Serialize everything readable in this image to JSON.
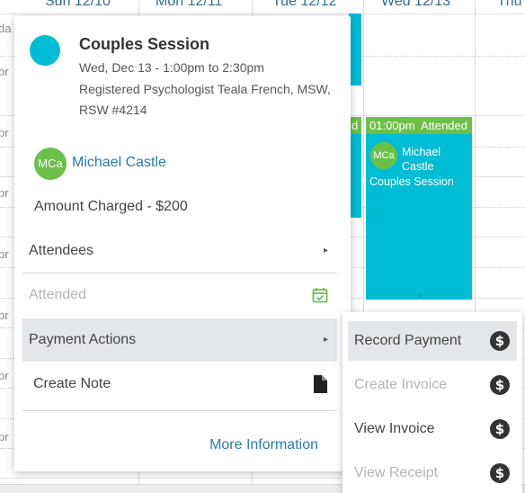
{
  "calendar": {
    "days": [
      "Sun 12/10",
      "Mon 12/11",
      "Tue 12/12",
      "Wed 12/13",
      "Thu"
    ],
    "time_labels": [
      "da",
      "pr",
      "pr",
      "pr",
      "pr",
      "pr",
      "pr",
      "pr"
    ],
    "event": {
      "header_time": "01:00pm",
      "header_status": "Attended",
      "avatar_initials": "MCa",
      "client_name": "Michael Castle",
      "session": "Couples Session",
      "handle": "=",
      "color": "#00bcd4",
      "status_color": "#6cc04a"
    },
    "fragment_label": "d"
  },
  "popover": {
    "title": "Couples Session",
    "datetime": "Wed, Dec 13 - 1:00pm to 2:30pm",
    "provider_line1": "Registered Psychologist Teala French, MSW,",
    "provider_line2": "RSW #4214",
    "client_initials": "MCa",
    "client_name": "Michael Castle",
    "amount": "Amount Charged - $200",
    "menu": {
      "attendees": "Attendees",
      "attended": "Attended",
      "payment_actions": "Payment Actions",
      "create_note": "Create Note"
    },
    "more_information": "More Information"
  },
  "submenu": {
    "record_payment": "Record Payment",
    "create_invoice": "Create Invoice",
    "view_invoice": "View Invoice",
    "view_receipt": "View Receipt",
    "dollar_glyph": "$"
  },
  "icons": {
    "arrow": "▸",
    "attended_icon": "calendar-check-icon",
    "note_icon": "document-icon",
    "payment_icon": "dollar-circle-icon"
  }
}
